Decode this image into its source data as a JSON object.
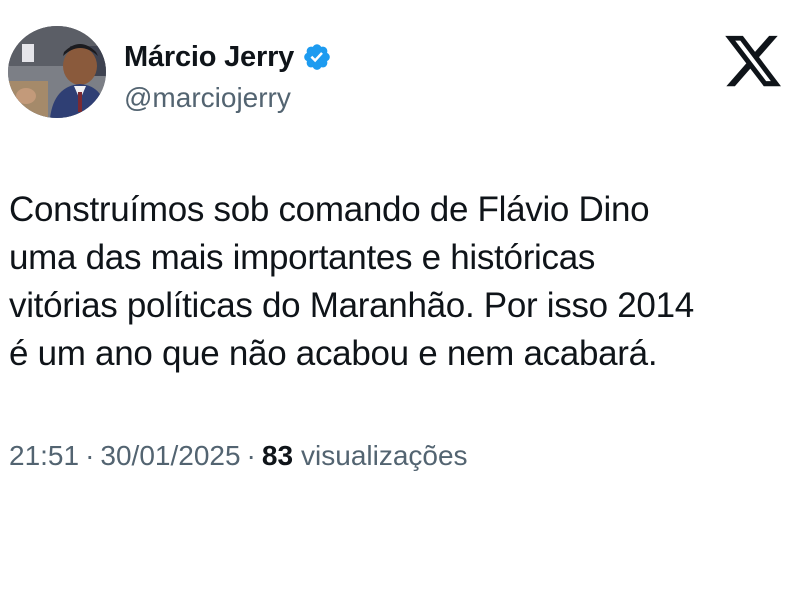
{
  "author": {
    "display_name": "Márcio Jerry",
    "handle": "@marciojerry",
    "verified": true,
    "verified_color": "#1d9bf0"
  },
  "platform": {
    "logo_icon": "x-logo-icon"
  },
  "tweet": {
    "lines": [
      "Construímos sob comando de Flávio Dino",
      "uma das mais importantes e históricas",
      "vitórias políticas do Maranhão. Por isso 2014",
      "é um ano que não acabou e nem acabará."
    ]
  },
  "meta": {
    "time": "21:51",
    "separator": "·",
    "date": "30/01/2025",
    "views_count": "83",
    "views_label": "visualizações"
  },
  "colors": {
    "text": "#0f1419",
    "secondary": "#536471",
    "accent": "#1d9bf0"
  }
}
